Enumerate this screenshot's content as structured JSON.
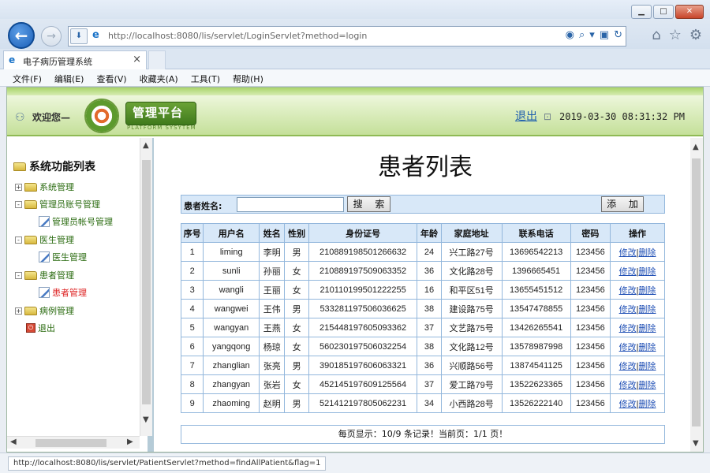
{
  "browser": {
    "url": "http://localhost:8080/lis/servlet/LoginServlet?method=login",
    "tab_title": "电子病历管理系统",
    "tab_close": "×",
    "menu": [
      "文件(F)",
      "编辑(E)",
      "查看(V)",
      "收藏夹(A)",
      "工具(T)",
      "帮助(H)"
    ],
    "status_url": "http://localhost:8080/lis/servlet/PatientServlet?method=findAllPatient&flag=1"
  },
  "header": {
    "welcome": "欢迎您—",
    "logo_title": "管理平台",
    "logo_subtitle": "PLATFORM SYSYTEM",
    "logout": "退出",
    "datetime": "2019-03-30 08:31:32 PM"
  },
  "sidebar": {
    "root": "系统功能列表",
    "nodes": [
      {
        "label": "系统管理",
        "type": "folder",
        "expand": "+"
      },
      {
        "label": "管理员账号管理",
        "type": "folder",
        "expand": "-"
      },
      {
        "label": "管理员帐号管理",
        "type": "leaf"
      },
      {
        "label": "医生管理",
        "type": "folder",
        "expand": "-"
      },
      {
        "label": "医生管理",
        "type": "leaf"
      },
      {
        "label": "患者管理",
        "type": "folder",
        "expand": "-"
      },
      {
        "label": "患者管理",
        "type": "leaf",
        "active": true
      },
      {
        "label": "病例管理",
        "type": "folder",
        "expand": "+"
      },
      {
        "label": "退出",
        "type": "exit"
      }
    ]
  },
  "main": {
    "title": "患者列表",
    "search_label": "患者姓名:",
    "search_value": "",
    "search_button": "搜 索",
    "add_button": "添 加",
    "columns": [
      "序号",
      "用户名",
      "姓名",
      "性别",
      "身份证号",
      "年龄",
      "家庭地址",
      "联系电话",
      "密码",
      "操作"
    ],
    "edit_label": "修改",
    "delete_label": "删除",
    "rows": [
      [
        "1",
        "liming",
        "李明",
        "男",
        "210889198501266632",
        "24",
        "兴工路27号",
        "13696542213",
        "123456"
      ],
      [
        "2",
        "sunli",
        "孙丽",
        "女",
        "210889197509063352",
        "36",
        "文化路28号",
        "1396665451",
        "123456"
      ],
      [
        "3",
        "wangli",
        "王丽",
        "女",
        "210110199501222255",
        "16",
        "和平区51号",
        "13655451512",
        "123456"
      ],
      [
        "4",
        "wangwei",
        "王伟",
        "男",
        "533281197506036625",
        "38",
        "建设路75号",
        "13547478855",
        "123456"
      ],
      [
        "5",
        "wangyan",
        "王燕",
        "女",
        "215448197605093362",
        "37",
        "文艺路75号",
        "13426265541",
        "123456"
      ],
      [
        "6",
        "yangqong",
        "杨琼",
        "女",
        "560230197506032254",
        "38",
        "文化路12号",
        "13578987998",
        "123456"
      ],
      [
        "7",
        "zhanglian",
        "张亮",
        "男",
        "390185197606063321",
        "36",
        "兴顺路56号",
        "13874541125",
        "123456"
      ],
      [
        "8",
        "zhangyan",
        "张岩",
        "女",
        "452145197609125564",
        "37",
        "爱工路79号",
        "13522623365",
        "123456"
      ],
      [
        "9",
        "zhaoming",
        "赵明",
        "男",
        "521412197805062231",
        "34",
        "小西路28号",
        "13526222140",
        "123456"
      ]
    ],
    "pagination": "每页显示：10/9 条记录！当前页：1/1 页！"
  }
}
